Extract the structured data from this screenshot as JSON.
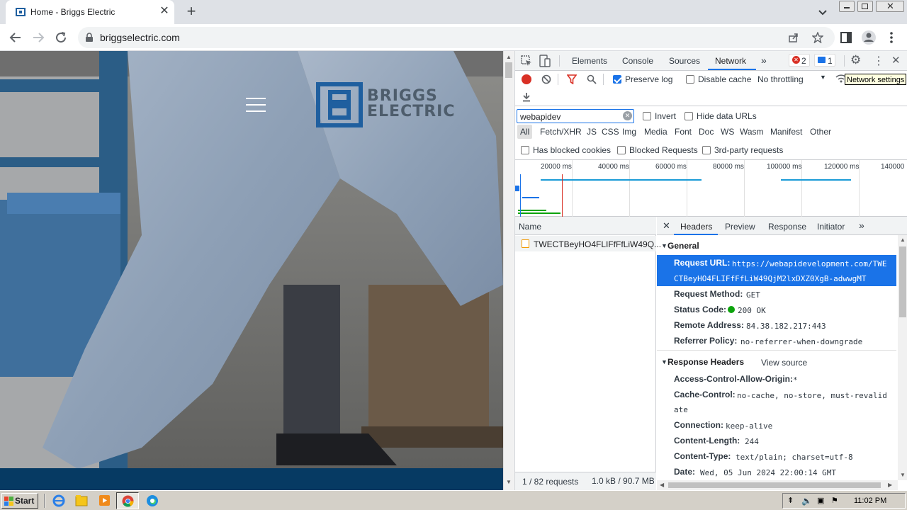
{
  "browser": {
    "tab_title": "Home - Briggs Electric",
    "url": "briggselectric.com"
  },
  "website": {
    "logo_line1": "BRIGGS",
    "logo_line2": "ELECTRIC"
  },
  "devtools": {
    "tabs": [
      "Elements",
      "Console",
      "Sources",
      "Network"
    ],
    "active_tab": "Network",
    "error_count": "2",
    "message_count": "1",
    "preserve_log": "Preserve log",
    "disable_cache": "Disable cache",
    "throttling": "No throttling",
    "network_settings_tooltip": "Network settings",
    "filter_value": "webapidev",
    "invert": "Invert",
    "hide_data_urls": "Hide data URLs",
    "type_filters": [
      "All",
      "Fetch/XHR",
      "JS",
      "CSS",
      "Img",
      "Media",
      "Font",
      "Doc",
      "WS",
      "Wasm",
      "Manifest",
      "Other"
    ],
    "has_blocked_cookies": "Has blocked cookies",
    "blocked_requests": "Blocked Requests",
    "third_party": "3rd-party requests",
    "timeline_ticks": [
      "20000 ms",
      "40000 ms",
      "60000 ms",
      "80000 ms",
      "100000 ms",
      "120000 ms",
      "140000"
    ],
    "name_header": "Name",
    "request_name": "TWECTBeyHO4FLIFfFfLiW49Q...",
    "detail_tabs": [
      "Headers",
      "Preview",
      "Response",
      "Initiator"
    ],
    "general_title": "General",
    "general": {
      "request_url_key": "Request URL:",
      "request_url_line1": "https://webapidevelopment.com/TWE",
      "request_url_line2": "CTBeyHO4FLIFfFfLiW49QjM2lxDXZ0XgB-adwwgMT",
      "request_method_key": "Request Method:",
      "request_method": "GET",
      "status_code_key": "Status Code:",
      "status_code": "200 OK",
      "remote_address_key": "Remote Address:",
      "remote_address": "84.38.182.217:443",
      "referrer_policy_key": "Referrer Policy:",
      "referrer_policy": "no-referrer-when-downgrade"
    },
    "response_headers_title": "Response Headers",
    "view_source": "View source",
    "response_headers": {
      "acao_key": "Access-Control-Allow-Origin:",
      "acao": "*",
      "cache_key": "Cache-Control:",
      "cache_line1": "no-cache, no-store, must-revalid",
      "cache_line2": "ate",
      "connection_key": "Connection:",
      "connection": "keep-alive",
      "length_key": "Content-Length:",
      "length": "244",
      "type_key": "Content-Type:",
      "type": "text/plain; charset=utf-8",
      "date_key": "Date:",
      "date": "Wed, 05 Jun 2024 22:00:14 GMT"
    },
    "requests_count": "1 / 82 requests",
    "transfer": "1.0 kB / 90.7 MB"
  },
  "taskbar": {
    "start": "Start",
    "clock": "11:02 PM"
  },
  "colors": {
    "devtools_selected": "#1a73e8",
    "record_red": "#d93025",
    "logo_blue": "#1f5f9f",
    "status_green": "#0ca30c"
  }
}
